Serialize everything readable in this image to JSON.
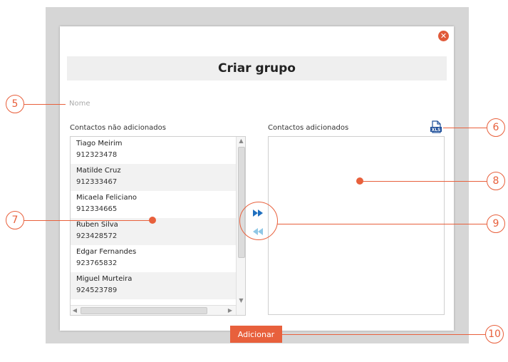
{
  "dialog": {
    "title": "Criar grupo",
    "close_icon": "close-icon",
    "name_placeholder": "Nome",
    "left_label": "Contactos não adicionados",
    "right_label": "Contactos adicionados",
    "xls_label": "XLS",
    "add_button": "Adicionar"
  },
  "contacts": [
    {
      "name": "Tiago Meirim",
      "phone": "912323478"
    },
    {
      "name": "Matilde Cruz",
      "phone": "912333467"
    },
    {
      "name": "Micaela Feliciano",
      "phone": "912334665"
    },
    {
      "name": "Ruben Silva",
      "phone": "923428572"
    },
    {
      "name": "Edgar Fernandes",
      "phone": "923765832"
    },
    {
      "name": "Miguel Murteira",
      "phone": "924523789"
    }
  ],
  "callouts": [
    "5",
    "6",
    "7",
    "8",
    "9",
    "10"
  ],
  "colors": {
    "accent": "#e8603c",
    "arrow_active": "#1f6fbf",
    "arrow_inactive": "#8fc7e6"
  }
}
